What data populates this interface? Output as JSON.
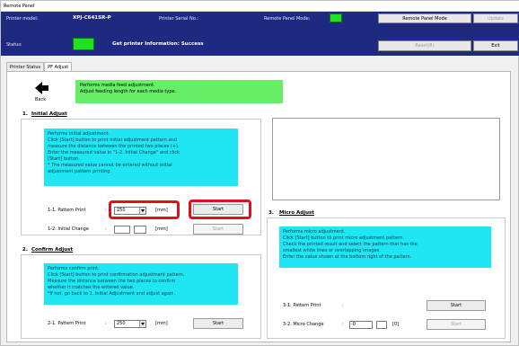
{
  "window": {
    "title": "Remote Panel"
  },
  "header": {
    "printer_model_label": "Printer model:",
    "printer_model_value": "XPJ-C641SR-P",
    "printer_serial_label": "Printer Serial No.:",
    "remote_panel_mode_label": "Remote Panel Mode:",
    "status_label": "Status:",
    "status_message": "Get printer Information: Success",
    "remote_panel_mode_button": "Remote Panel Mode",
    "update_button": "Update",
    "reset_button": "Reset(R)",
    "exit_button": "Exit",
    "indicator_color": "#1fe21f"
  },
  "tabs": [
    {
      "label": "Printer Status",
      "active": false
    },
    {
      "label": "PF Adjust",
      "active": true
    }
  ],
  "back": {
    "label": "Back"
  },
  "intro": {
    "line1": "Performs media feed adjustment.",
    "line2": "Adjust feeding length for each media type."
  },
  "initial_adjust": {
    "number": "1.",
    "title": "Initial Adjust",
    "desc": [
      "Performs initial adjustment.",
      "Click [Start] button to print initial adjustment pattern and",
      "measure the distance between the printed two places (+).",
      "Enter the measured value in \"1-2. Initial Change\" and click",
      "[Start] button.",
      " * The measured value cannot be entered without initial",
      " adjustment pattern printing."
    ],
    "row1_label": "1-1.   Pattern Print",
    "row1_colon": ":",
    "pattern_value": "250",
    "unit": "[mm]",
    "start_button": "Start",
    "row2_label": "1-2.   Initial Change",
    "row2_colon": ":",
    "initial_change_value": "",
    "start_button_2": "Start"
  },
  "confirm_adjust": {
    "number": "2.",
    "title": "Confirm Adjust",
    "desc": [
      "Performs confirm print.",
      "Click [Start] button to print confirmation adjustment pattern.",
      "Measure the distance between the two places to confirm",
      "whether it matches the entered value.",
      "*If not, go back to 1. Initial Adjustment and adjust again."
    ],
    "row1_label": "2-1.   Pattern Print",
    "row1_colon": ":",
    "pattern_value": "250",
    "unit": "[mm]",
    "start_button": "Start"
  },
  "micro_adjust": {
    "number": "3.",
    "title": "Micro Adjust",
    "desc": [
      "Performs micro adjustment.",
      "Click [Start] button to print micro adjustment pattern.",
      "Check the printed result and select the pattern that has the",
      "smallest white lines or overlapping images.",
      "Enter the value shown at the bottom right of the pattern."
    ],
    "row1_label": "3-1.   Pattern Print",
    "row1_colon": ":",
    "start_button": "Start",
    "row2_label": "3-2.   Micro Change",
    "row2_colon": ":",
    "micro_value": "-0",
    "unit": "[0]",
    "start_button_2": "Start"
  }
}
